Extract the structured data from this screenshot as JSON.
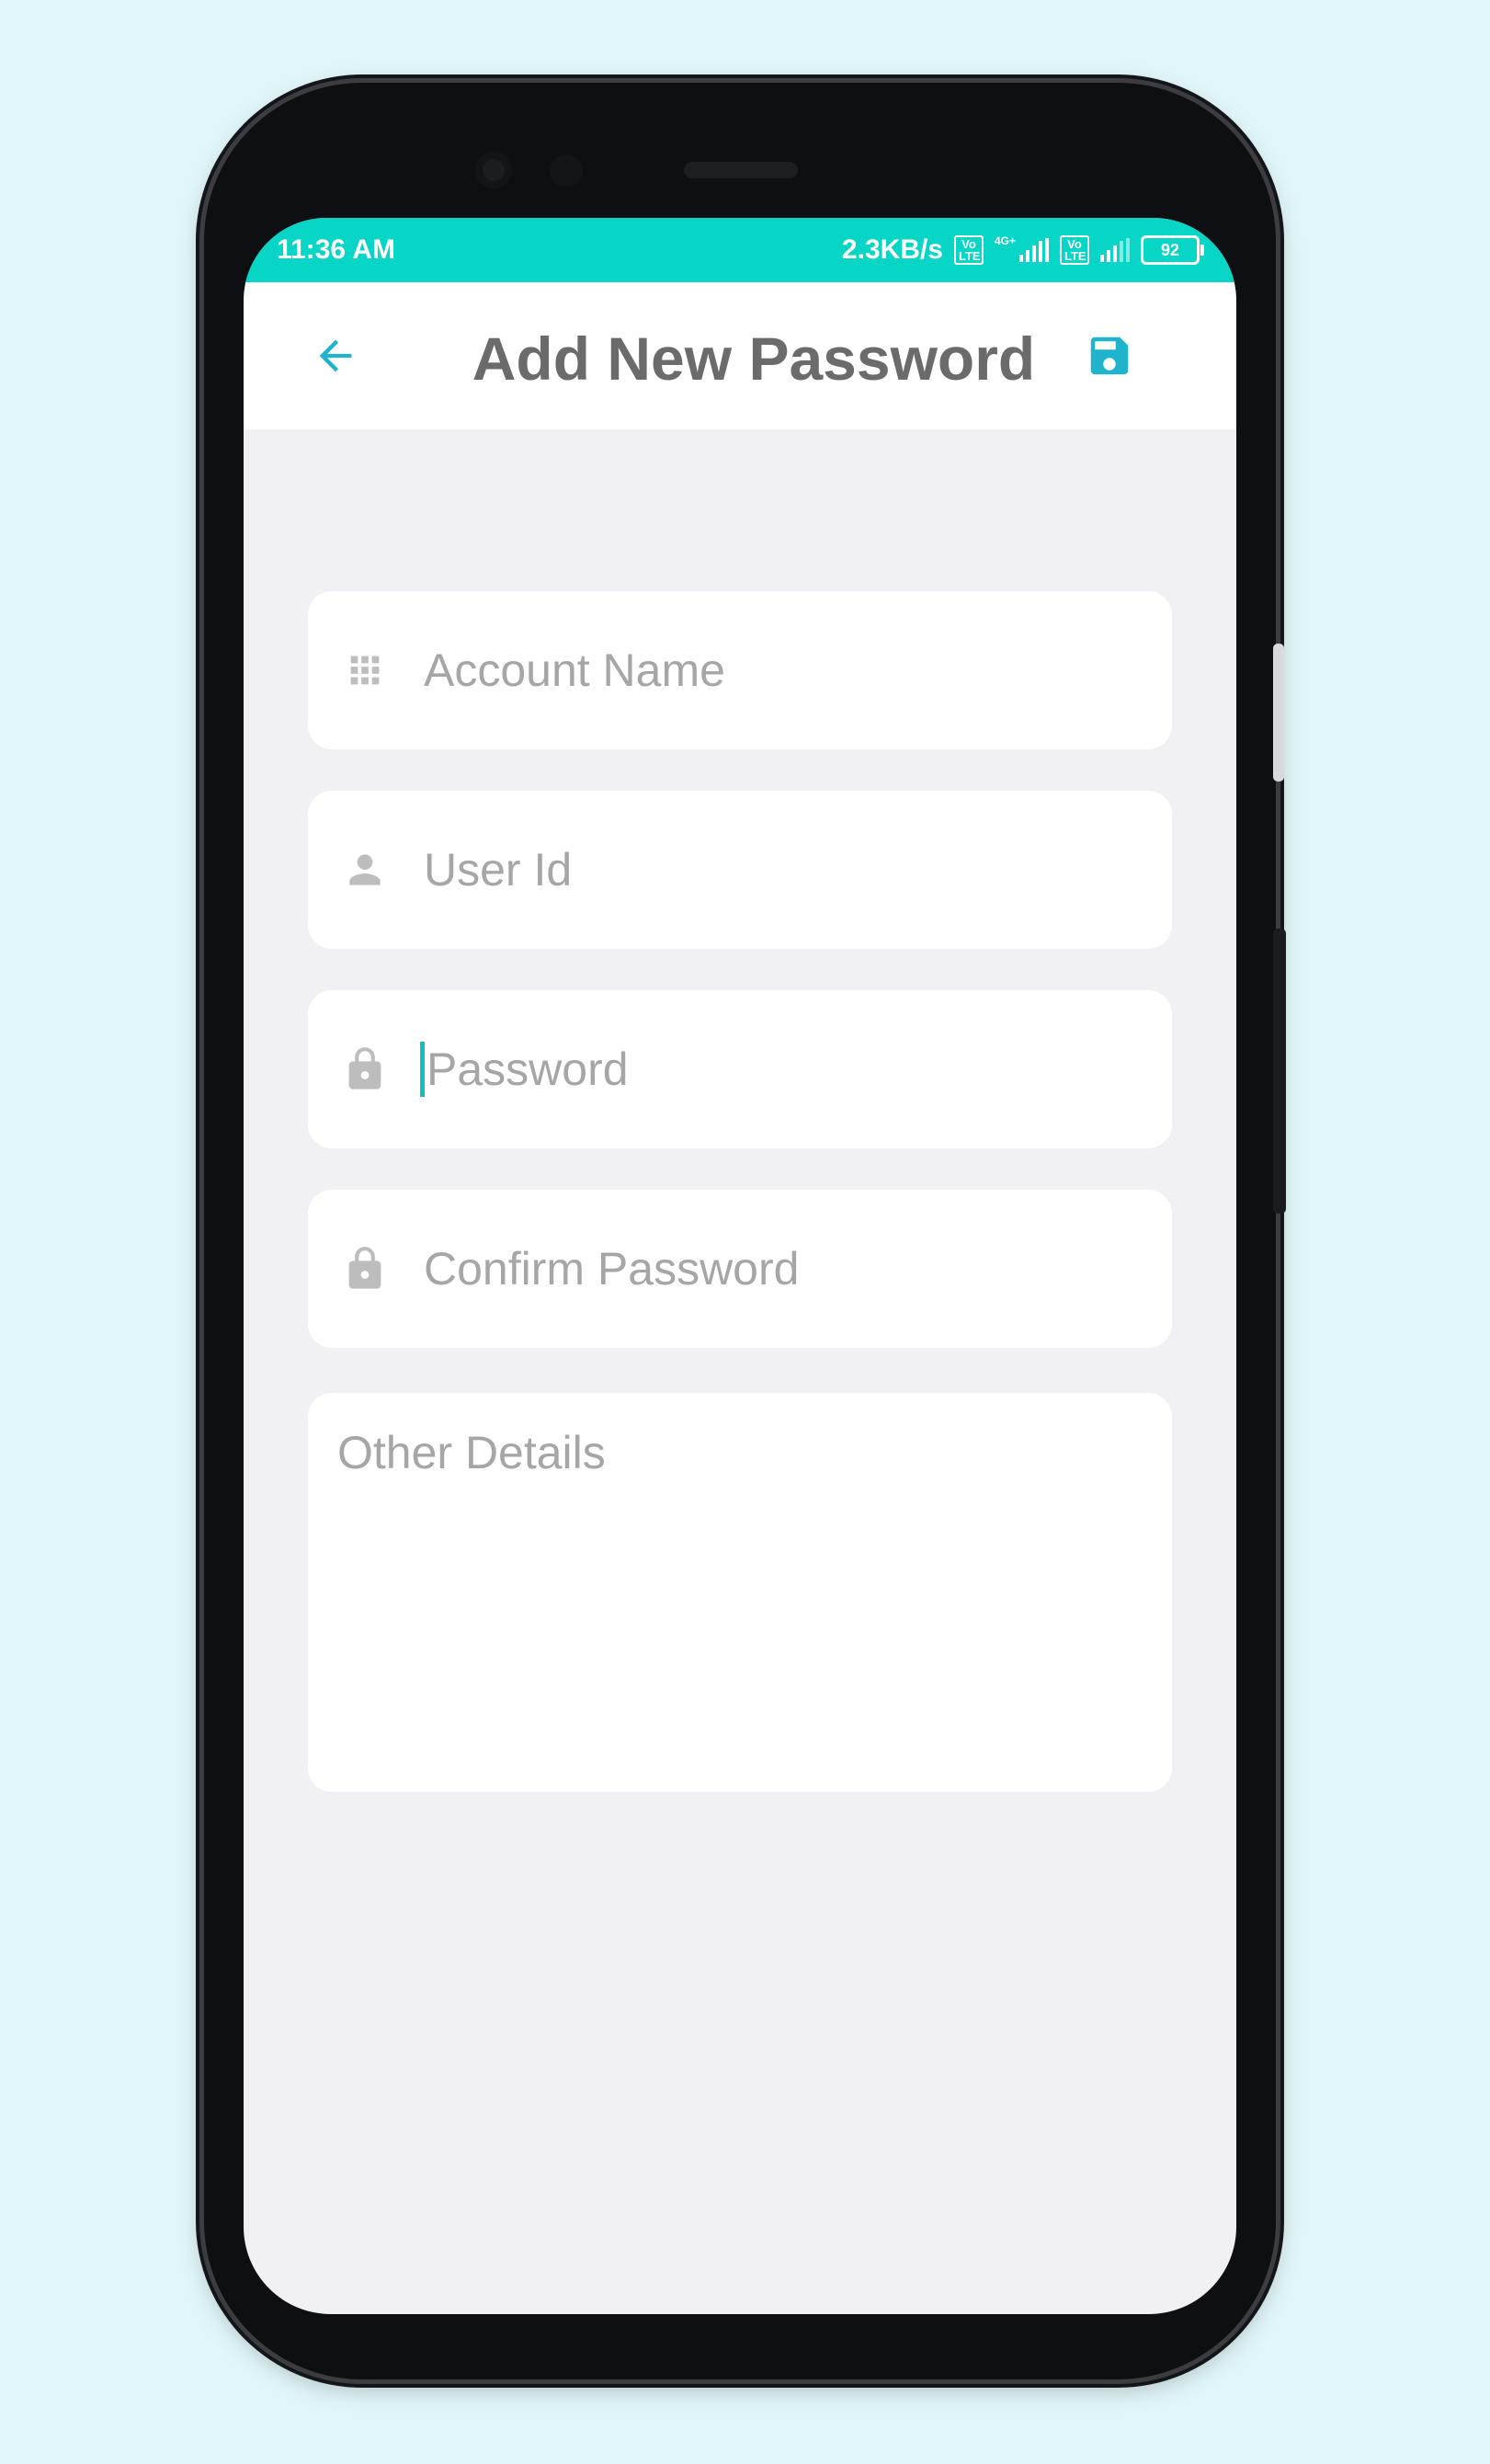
{
  "status_bar": {
    "time": "11:36 AM",
    "speed": "2.3KB/s",
    "volte1": "Vo LTE",
    "network_type": "4G+",
    "volte2": "Vo LTE",
    "battery": "92"
  },
  "header": {
    "title": "Add New Password",
    "back_icon": "arrow-left-icon",
    "save_icon": "floppy-disk-icon"
  },
  "form": {
    "account_name": {
      "placeholder": "Account Name",
      "value": "",
      "icon": "grid-icon"
    },
    "user_id": {
      "placeholder": "User Id",
      "value": "",
      "icon": "person-icon"
    },
    "password": {
      "placeholder": "Password",
      "value": "",
      "icon": "lock-icon"
    },
    "confirm_password": {
      "placeholder": "Confirm Password",
      "value": "",
      "icon": "lock-icon"
    },
    "other_details": {
      "placeholder": "Other Details",
      "value": ""
    }
  },
  "colors": {
    "accent": "#07d6c7",
    "icon_accent": "#1fb3cc",
    "title": "#6b6b6b",
    "placeholder": "#a6a6a6",
    "screen_bg": "#f1f1f5",
    "page_bg": "#e0f6f8"
  }
}
